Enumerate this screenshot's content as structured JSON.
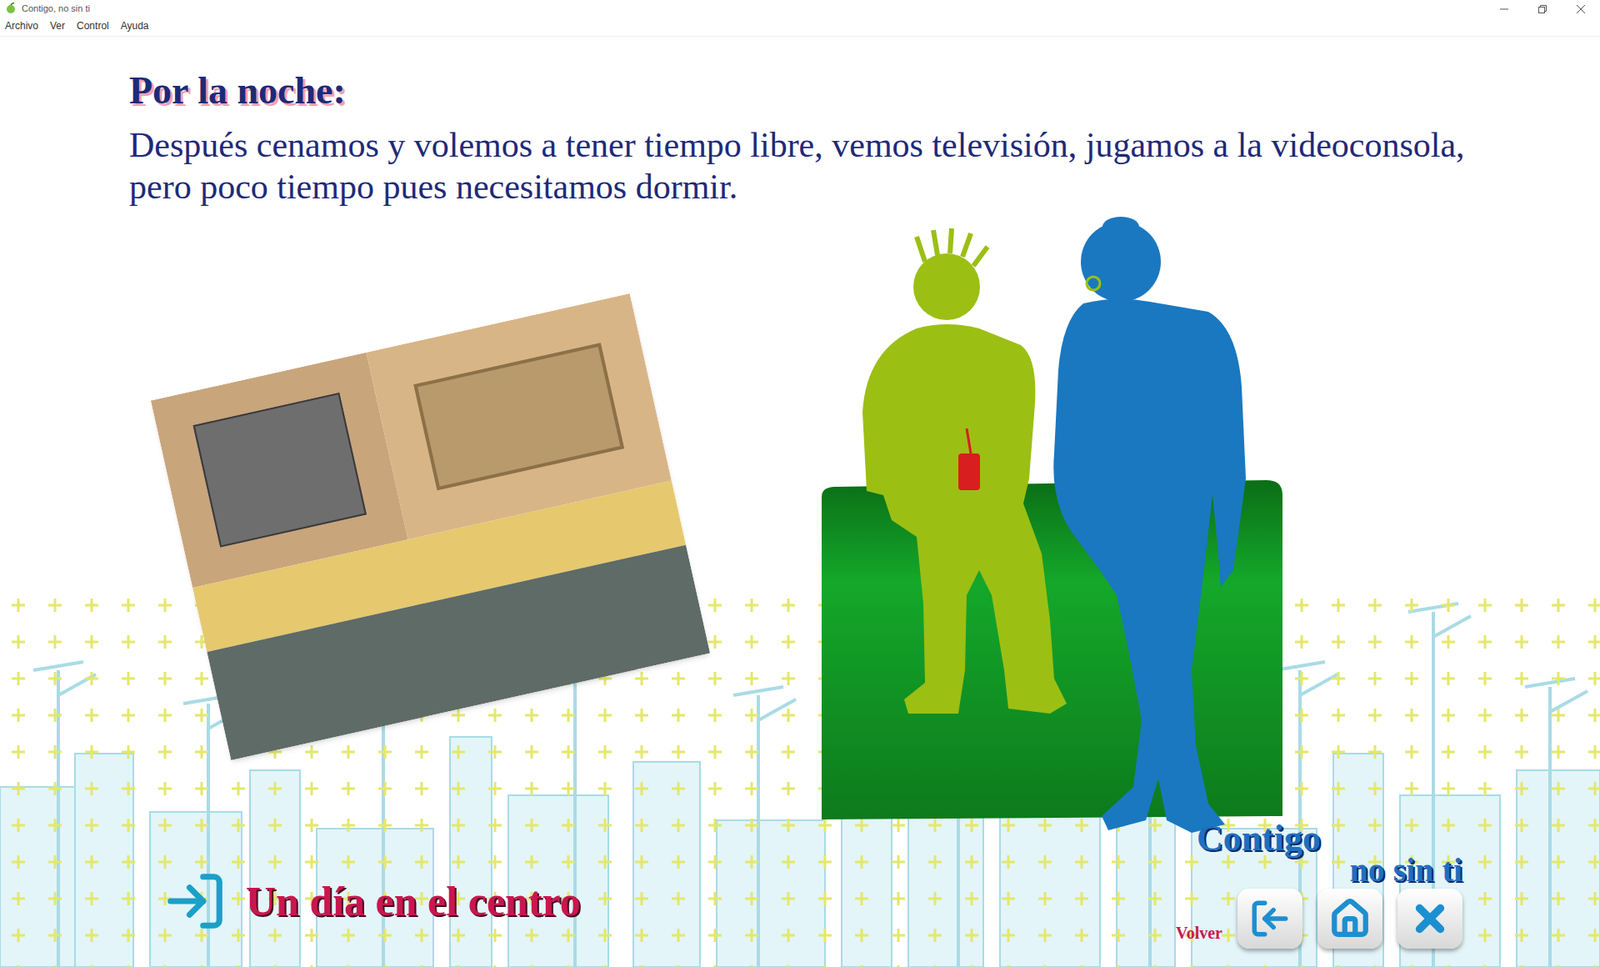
{
  "window": {
    "title": "Contigo, no sin ti",
    "menu": [
      "Archivo",
      "Ver",
      "Control",
      "Ayuda"
    ]
  },
  "heading": "Por la noche:",
  "body": "Después cenamos y volemos a tener tiempo libre, vemos televisión, jugamos a la videoconsola, pero poco tiempo pues necesitamos dormir.",
  "section_link": {
    "label": "Un día en el centro"
  },
  "logo": {
    "line1": "Contigo",
    "line2": "no sin ti"
  },
  "nav": {
    "back_label": "Volver"
  }
}
